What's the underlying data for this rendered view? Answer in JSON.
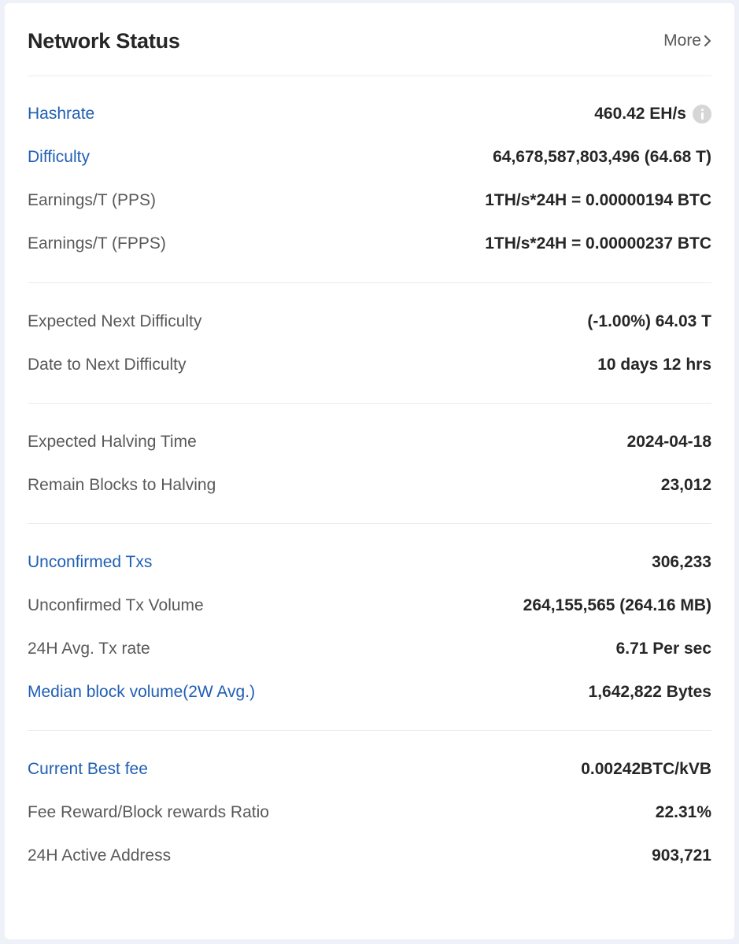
{
  "header": {
    "title": "Network Status",
    "more_label": "More"
  },
  "groups": [
    {
      "rows": [
        {
          "label": "Hashrate",
          "value": "460.42 EH/s",
          "link": true,
          "info_icon": "info-icon"
        },
        {
          "label": "Difficulty",
          "value": "64,678,587,803,496 (64.68 T)",
          "link": true
        },
        {
          "label": "Earnings/T (PPS)",
          "value": "1TH/s*24H = 0.00000194 BTC",
          "link": false
        },
        {
          "label": "Earnings/T (FPPS)",
          "value": "1TH/s*24H = 0.00000237 BTC",
          "link": false
        }
      ]
    },
    {
      "rows": [
        {
          "label": "Expected Next Difficulty",
          "value": "(-1.00%) 64.03 T",
          "link": false
        },
        {
          "label": "Date to Next Difficulty",
          "value": "10 days 12 hrs",
          "link": false
        }
      ]
    },
    {
      "rows": [
        {
          "label": "Expected Halving Time",
          "value": "2024-04-18",
          "link": false
        },
        {
          "label": "Remain Blocks to Halving",
          "value": "23,012",
          "link": false
        }
      ]
    },
    {
      "rows": [
        {
          "label": "Unconfirmed Txs",
          "value": "306,233",
          "link": true
        },
        {
          "label": "Unconfirmed Tx Volume",
          "value": "264,155,565 (264.16 MB)",
          "link": false
        },
        {
          "label": "24H Avg. Tx rate",
          "value": "6.71 Per sec",
          "link": false
        },
        {
          "label": "Median block volume(2W Avg.)",
          "value": "1,642,822 Bytes",
          "link": true
        }
      ]
    },
    {
      "rows": [
        {
          "label": "Current Best fee",
          "value": "0.00242BTC/kVB",
          "link": true
        },
        {
          "label": "Fee Reward/Block rewards Ratio",
          "value": "22.31%",
          "link": false
        },
        {
          "label": "24H Active Address",
          "value": "903,721",
          "link": false
        }
      ]
    }
  ],
  "colors": {
    "link": "#1f5fb3",
    "label": "#595959",
    "value": "#262626",
    "divider": "#ebebeb",
    "background": "#eef2f8"
  }
}
